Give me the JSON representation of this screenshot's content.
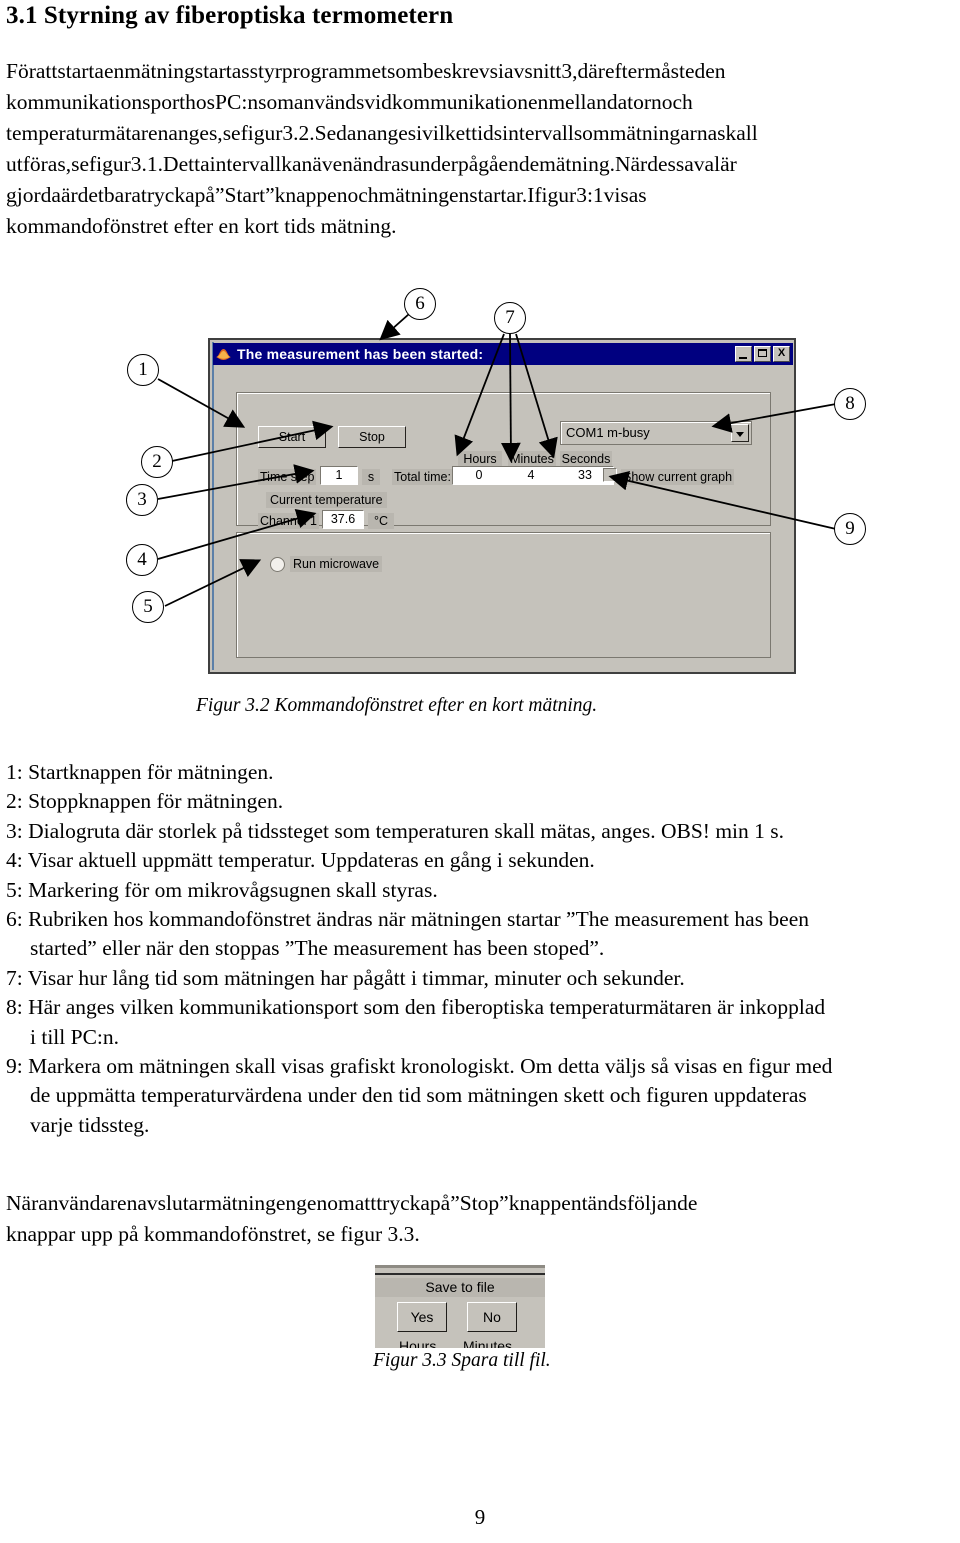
{
  "heading": "3.1 Styrning av fiberoptiska termometern",
  "paragraph1": {
    "lines": [
      "För att starta en mätning startas styrprogrammet som beskrevs i avsnitt 3, därefter måste den",
      "kommunikationsport hos PC:n som används vid kommunikationen mellan datorn och",
      "temperaturmätaren anges, se figur 3.2. Sedan anges i vilket tidsintervall som mätningarna skall",
      "utföras, se figur 3.1. Detta intervall kan även ändras under pågående mätning. När dessa val är",
      "gjorda är det bara trycka på ”Start” knappen och mätningen startar. I figur 3:1 visas",
      "kommandofönstret efter en kort tids mätning."
    ]
  },
  "figure32": {
    "caption": "Figur 3.2 Kommandofönstret efter en kort mätning.",
    "window": {
      "title": "The measurement has been started:",
      "icon": "matlab-membrane-icon",
      "minimize_label": "_",
      "maximize_label": "□",
      "close_label": "X"
    },
    "controls": {
      "start_button": "Start",
      "stop_button": "Stop",
      "time_step_label": "Time step",
      "time_step_value": "1",
      "time_step_unit": "s",
      "total_time_label": "Total time:",
      "hours_label": "Hours",
      "minutes_label": "Minutes",
      "seconds_label": "Seconds",
      "hours_value": "0",
      "minutes_value": "4",
      "seconds_value": "33",
      "current_temperature_label": "Current temperature",
      "channel_label": "Channel 1",
      "channel_value": "37.6",
      "degree_unit": "°C",
      "port_value": "COM1 m-busy",
      "show_graph_label": "Show current graph",
      "run_microwave_label": "Run microwave"
    },
    "callouts": [
      {
        "num": "1"
      },
      {
        "num": "2"
      },
      {
        "num": "3"
      },
      {
        "num": "4"
      },
      {
        "num": "5"
      },
      {
        "num": "6"
      },
      {
        "num": "7"
      },
      {
        "num": "8"
      },
      {
        "num": "9"
      }
    ]
  },
  "legend": [
    {
      "text": "1: Startknappen för mätningen."
    },
    {
      "text": "2: Stoppknappen för mätningen."
    },
    {
      "text": "3: Dialogruta där storlek på tidssteget som temperaturen skall mätas, anges. OBS! min 1 s."
    },
    {
      "text": "4: Visar aktuell uppmätt temperatur. Uppdateras en gång i sekunden."
    },
    {
      "text": "5: Markering för om mikrovågsugnen skall styras."
    },
    {
      "text": "6: Rubriken hos kommandofönstret ändras när mätningen startar ”The measurement has been",
      "cont": "started” eller när den stoppas ”The measurement has been stoped”."
    },
    {
      "text": "7: Visar hur lång tid som mätningen har pågått i timmar, minuter och sekunder."
    },
    {
      "text": "8: Här anges vilken kommunikationsport som den fiberoptiska temperaturmätaren är inkopplad",
      "cont": " i till PC:n."
    },
    {
      "text": "9: Markera om mätningen skall visas grafiskt kronologiskt. Om detta väljs så visas en figur med",
      "cont": "de uppmätta temperaturvärdena under den tid som mätningen skett och figuren uppdateras",
      "cont2": "varje tidssteg."
    }
  ],
  "paragraph2": {
    "lines": [
      "När användaren avslutar mätningen genom att trycka på ”Stop” knappen tänds följande",
      "knappar upp på kommandofönstret, se figur 3.3."
    ]
  },
  "figure33": {
    "caption": "Figur 3.3 Spara till fil.",
    "title": "Save to file",
    "yes_button": "Yes",
    "no_button": "No",
    "hours_label": "Hours",
    "minutes_label": "Minutes"
  },
  "page_number": "9",
  "colors": {
    "titlebar": "#000080",
    "dialog_face": "#c5c2bb",
    "field_bg": "#ffffff",
    "text": "#000000"
  }
}
